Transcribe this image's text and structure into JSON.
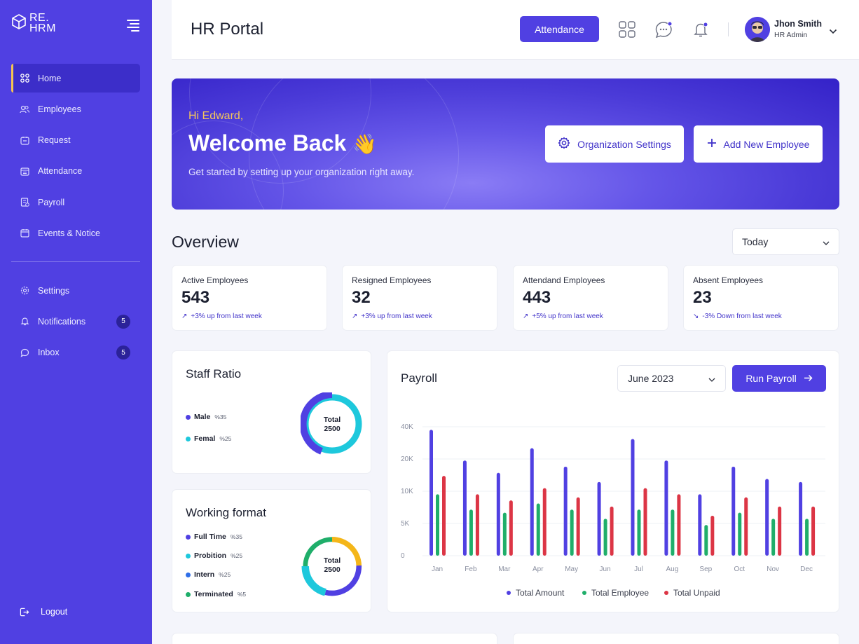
{
  "brand": {
    "logo_text": "RE.\nHRM"
  },
  "sidebar": {
    "items": [
      {
        "label": "Home",
        "icon": "grid-icon"
      },
      {
        "label": "Employees",
        "icon": "users-icon"
      },
      {
        "label": "Request",
        "icon": "request-icon"
      },
      {
        "label": "Attendance",
        "icon": "calendar-list-icon"
      },
      {
        "label": "Payroll",
        "icon": "payroll-icon"
      },
      {
        "label": "Events & Notice",
        "icon": "calendar-icon"
      }
    ],
    "secondary": [
      {
        "label": "Settings",
        "icon": "gear-icon"
      },
      {
        "label": "Notifications",
        "icon": "bell-icon",
        "badge": "5"
      },
      {
        "label": "Inbox",
        "icon": "chat-icon",
        "badge": "5"
      }
    ],
    "logout": "Logout"
  },
  "header": {
    "title": "HR Portal",
    "attendance_button": "Attendance",
    "user": {
      "name": "Jhon Smith",
      "role": "HR Admin"
    }
  },
  "banner": {
    "greeting": "Hi Edward,",
    "headline": "Welcome Back",
    "emoji": "👋",
    "subtitle": "Get started by setting up your organization right away.",
    "org_settings_button": "Organization Settings",
    "add_employee_button": "Add New Employee"
  },
  "overview": {
    "title": "Overview",
    "period": "Today",
    "stats": [
      {
        "label": "Active Employees",
        "value": "543",
        "delta": "+3% up from last week"
      },
      {
        "label": "Resigned Employees",
        "value": "32",
        "delta": "+3% up from last week"
      },
      {
        "label": "Attendand Employees",
        "value": "443",
        "delta": "+5% up from last week"
      },
      {
        "label": "Absent Employees",
        "value": "23",
        "delta": "-3% Down from last week"
      }
    ]
  },
  "staff_ratio": {
    "title": "Staff Ratio",
    "legend": [
      {
        "label": "Male",
        "pct": "%35",
        "color": "#5040e2"
      },
      {
        "label": "Femal",
        "pct": "%25",
        "color": "#1ec8dc"
      }
    ],
    "center_label": "Total",
    "center_value": "2500"
  },
  "working_format": {
    "title": "Working format",
    "legend": [
      {
        "label": "Full Time",
        "pct": "%35",
        "color": "#5040e2"
      },
      {
        "label": "Probition",
        "pct": "%25",
        "color": "#1ec8dc"
      },
      {
        "label": "Intern",
        "pct": "%25",
        "color": "#2f6ee8"
      },
      {
        "label": "Terminated",
        "pct": "%5",
        "color": "#1fae6a"
      }
    ],
    "center_label": "Total",
    "center_value": "2500"
  },
  "payroll": {
    "title": "Payroll",
    "month": "June 2023",
    "run_button": "Run Payroll"
  },
  "chart_data": {
    "type": "bar",
    "categories": [
      "Jan",
      "Feb",
      "Mar",
      "Apr",
      "May",
      "Jun",
      "Jul",
      "Aug",
      "Sep",
      "Oct",
      "Nov",
      "Dec"
    ],
    "y_ticks": [
      "40K",
      "20K",
      "10K",
      "5K",
      "0"
    ],
    "series": [
      {
        "name": "Total Amount",
        "color": "#5040e2",
        "values": [
          41,
          31,
          27,
          35,
          29,
          24,
          38,
          31,
          20,
          29,
          25,
          24
        ]
      },
      {
        "name": "Total Employee",
        "color": "#1fae6a",
        "values": [
          20,
          15,
          14,
          17,
          15,
          12,
          15,
          15,
          10,
          14,
          12,
          12
        ]
      },
      {
        "name": "Total Unpaid",
        "color": "#dc3545",
        "values": [
          26,
          20,
          18,
          22,
          19,
          16,
          22,
          20,
          13,
          19,
          16,
          16
        ]
      }
    ],
    "grid": true,
    "legend": "bottom"
  }
}
